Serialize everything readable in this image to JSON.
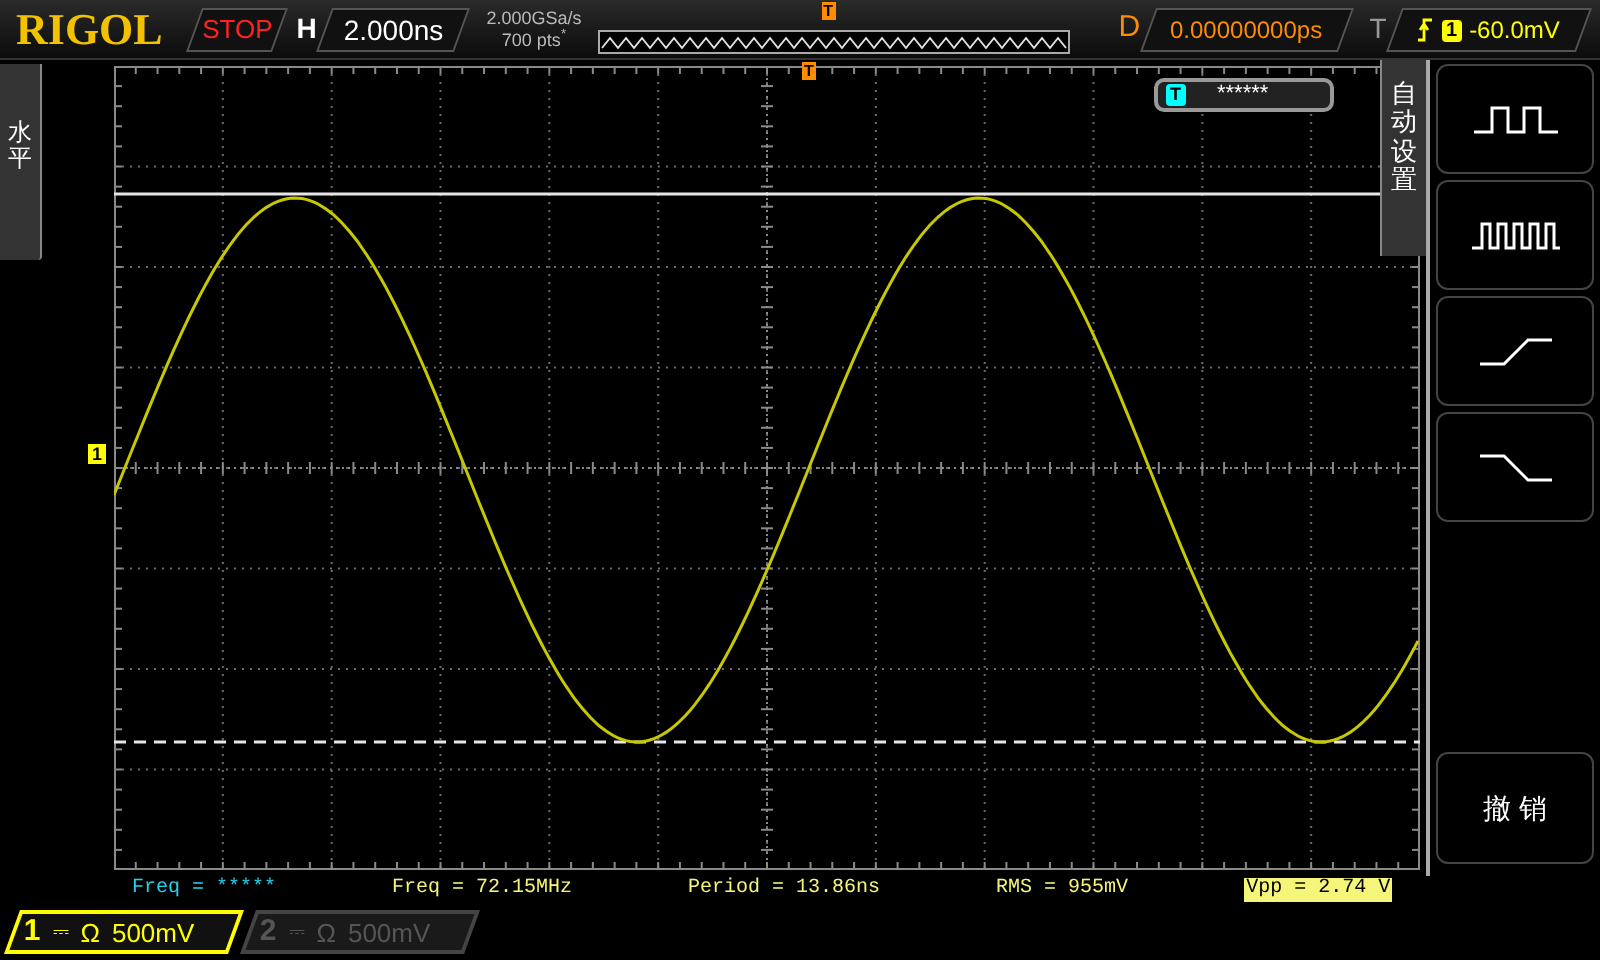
{
  "top_bar": {
    "logo": "RIGOL",
    "run_status": "STOP",
    "horizontal_label": "H",
    "timebase": "2.000ns",
    "sample_rate": "2.000GSa/s",
    "memory_depth": "700 pts$^{*}$",
    "trigger_position_marker": "T",
    "delay_label": "D",
    "delay": "0.00000000ps",
    "trigger_label": "T",
    "trigger_source": "1",
    "trigger_level": "-60.0mV"
  },
  "left_tab": {
    "label": "水平"
  },
  "screen": {
    "trigger_marker": "T",
    "channel_marker": "1",
    "trigger_popup": {
      "icon_label": "T",
      "text": "******"
    }
  },
  "auto_set_menu": {
    "title": "自动设置",
    "items": [
      {
        "kind": "single-pulse"
      },
      {
        "kind": "multi-pulse"
      },
      {
        "kind": "rising-edge"
      },
      {
        "kind": "falling-edge"
      },
      {
        "kind": "spacer"
      },
      {
        "kind": "text",
        "label": "撤 销"
      }
    ]
  },
  "measurements": [
    {
      "text": "Freq = *****",
      "color": "#22d3ee",
      "selected": false
    },
    {
      "text": "Freq = 72.15MHz",
      "color": "#f5f57a",
      "selected": false
    },
    {
      "text": "Period = 13.86ns",
      "color": "#f5f57a",
      "selected": false
    },
    {
      "text": "RMS = 955mV",
      "color": "#f5f57a",
      "selected": false
    },
    {
      "text": "Vpp = 2.74 V",
      "color": "#f5f57a",
      "selected": true
    }
  ],
  "channels": [
    {
      "number": "1",
      "coupling": "⎓",
      "impedance": "Ω",
      "scale": "500mV",
      "selected": true
    },
    {
      "number": "2",
      "coupling": "⎓",
      "impedance": "Ω",
      "scale": "500mV",
      "selected": false
    }
  ]
}
